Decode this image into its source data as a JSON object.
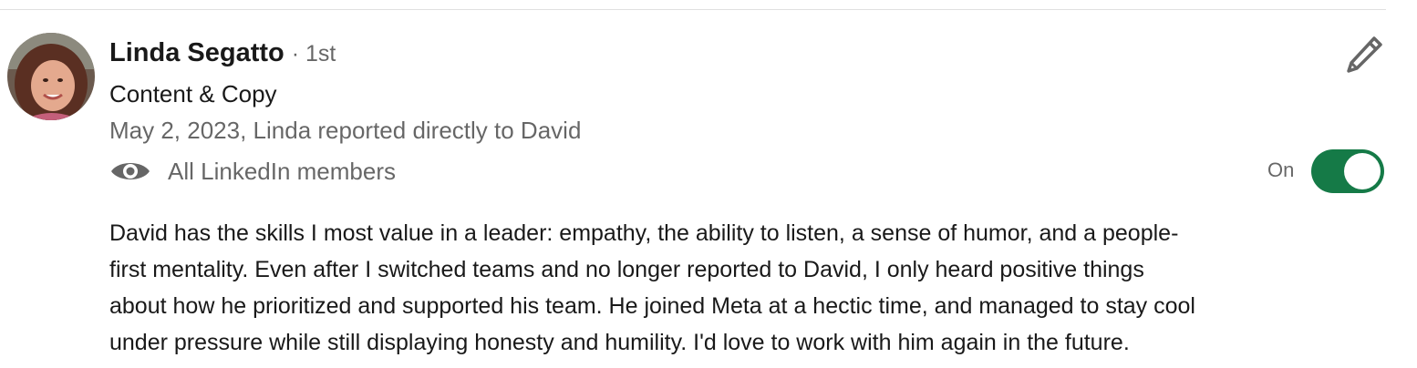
{
  "recommendation": {
    "author": {
      "name": "Linda Segatto",
      "degree": "· 1st",
      "headline": "Content & Copy"
    },
    "meta": "May 2, 2023, Linda reported directly to David",
    "visibility": {
      "icon": "eye-icon",
      "label": "All LinkedIn members"
    },
    "toggle": {
      "label": "On",
      "state": "on",
      "color": "#157a47"
    },
    "edit_icon": "pencil-icon",
    "text_lines": [
      "David has the skills I most value in a leader: empathy, the ability to listen, a sense of humor, and a people-",
      "first mentality. Even after I switched teams and no longer reported to David, I only heard positive things",
      "about how he prioritized and supported his team. He joined Meta at a hectic time, and managed to stay cool",
      "under pressure while still displaying honesty and humility. I'd love to work with him again in the future."
    ]
  }
}
